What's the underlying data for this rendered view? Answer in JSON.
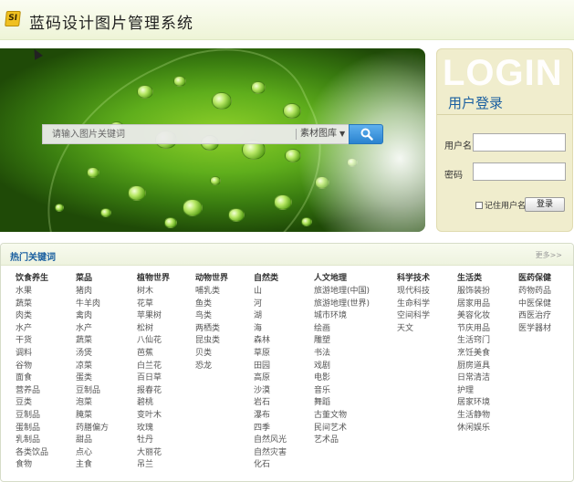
{
  "header": {
    "logo_text": "SI",
    "title": "蓝码设计图片管理系统"
  },
  "search": {
    "placeholder": "请输入图片关键词",
    "scope": "素材图库",
    "button": "search-icon"
  },
  "login": {
    "watermark": "LOGIN",
    "title": "用户登录",
    "username_label": "用户名",
    "password_label": "密码",
    "remember_label": "记住用户名",
    "submit": "登录"
  },
  "hot": {
    "title": "热门关键词",
    "more": "更多>>",
    "columns": [
      {
        "heading": "饮食养生",
        "items": [
          "水果",
          "蔬菜",
          "肉类",
          "水产",
          "干货",
          "调料",
          "谷物",
          "面食",
          "营养品",
          "豆类",
          "豆制品",
          "蛋制品",
          "乳制品",
          "各类饮品",
          "食物"
        ]
      },
      {
        "heading": "菜品",
        "items": [
          "猪肉",
          "牛羊肉",
          "禽肉",
          "水产",
          "蔬菜",
          "汤煲",
          "凉菜",
          "蛋类",
          "豆制品",
          "泡菜",
          "腌菜",
          "药膳偏方",
          "甜品",
          "点心",
          "主食"
        ]
      },
      {
        "heading": "植物世界",
        "items": [
          "树木",
          "花草",
          "苹果树",
          "松树",
          "八仙花",
          "芭蕉",
          "白兰花",
          "百日草",
          "报春花",
          "碧桃",
          "变叶木",
          "玫瑰",
          "牡丹",
          "大丽花",
          "吊兰"
        ]
      },
      {
        "heading": "动物世界",
        "items": [
          "哺乳类",
          "鱼类",
          "鸟类",
          "两栖类",
          "昆虫类",
          "贝类",
          "恐龙"
        ]
      },
      {
        "heading": "自然类",
        "items": [
          "山",
          "河",
          "湖",
          "海",
          "森林",
          "草原",
          "田园",
          "高原",
          "沙漠",
          "岩石",
          "瀑布",
          "四季",
          "自然风光",
          "自然灾害",
          "化石"
        ]
      },
      {
        "heading": "人文地理",
        "items": [
          "旅游地理(中国)",
          "旅游地理(世界)",
          "城市环境",
          "绘画",
          "雕塑",
          "书法",
          "戏剧",
          "电影",
          "音乐",
          "舞蹈",
          "古董文物",
          "民间艺术",
          "艺术品"
        ]
      },
      {
        "heading": "科学技术",
        "items": [
          "现代科技",
          "生命科学",
          "空间科学",
          "天文"
        ]
      },
      {
        "heading": "生活类",
        "items": [
          "服饰装扮",
          "居家用品",
          "美容化妆",
          "节庆用品",
          "生活窍门",
          "烹饪美食",
          "厨房道具",
          "日常清洁",
          "护理",
          "居家环境",
          "生活静物",
          "休闲娱乐"
        ]
      },
      {
        "heading": "医药保健",
        "items": [
          "药物药品",
          "中医保健",
          "西医治疗",
          "医学器材"
        ]
      }
    ]
  }
}
